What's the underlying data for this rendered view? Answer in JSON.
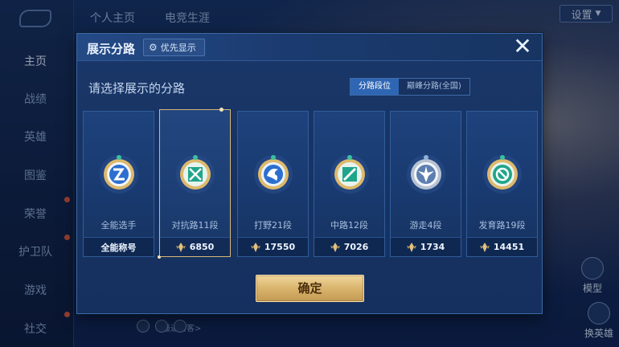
{
  "background": {
    "nav": [
      "主页",
      "战绩",
      "英雄",
      "图鉴",
      "荣誉",
      "护卫队",
      "游戏",
      "社交"
    ],
    "active_nav": "主页",
    "top_tabs": [
      "个人主页",
      "电竞生涯"
    ],
    "settings_label": "设置",
    "visitors_label": "最近访客>",
    "side_buttons": [
      "模型",
      "换英雄"
    ]
  },
  "modal": {
    "title": "展示分路",
    "priority_button": "优先显示",
    "close_symbol": "✕",
    "subtitle": "请选择展示的分路",
    "toggle": {
      "options": [
        "分路段位",
        "巅峰分路(全国)"
      ],
      "selected": "分路段位"
    },
    "cards": [
      {
        "name": "全能选手",
        "footer": "全能称号",
        "has_score_icon": false,
        "icon": "all-round-emblem",
        "selected": false
      },
      {
        "name": "对抗路11段",
        "footer": "6850",
        "has_score_icon": true,
        "icon": "clash-lane-emblem",
        "selected": true
      },
      {
        "name": "打野21段",
        "footer": "17550",
        "has_score_icon": true,
        "icon": "jungle-emblem",
        "selected": false
      },
      {
        "name": "中路12段",
        "footer": "7026",
        "has_score_icon": true,
        "icon": "mid-lane-emblem",
        "selected": false
      },
      {
        "name": "游走4段",
        "footer": "1734",
        "has_score_icon": true,
        "icon": "roam-emblem",
        "selected": false
      },
      {
        "name": "发育路19段",
        "footer": "14451",
        "has_score_icon": true,
        "icon": "farm-lane-emblem",
        "selected": false
      }
    ],
    "confirm_label": "确定"
  },
  "colors": {
    "accent_gold": "#d9b46d",
    "toggle_active": "#2f66b4",
    "emblem_teal": "#1fa58a",
    "emblem_blue": "#2c6fd0"
  }
}
